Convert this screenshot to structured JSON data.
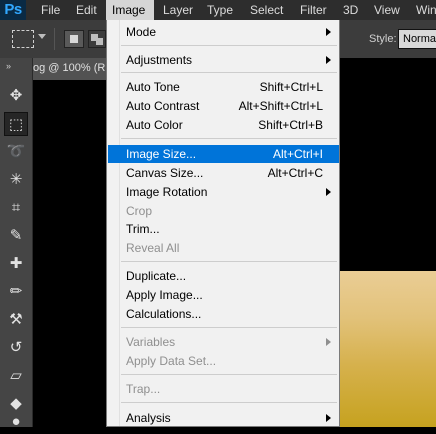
{
  "menubar": {
    "logo": "Ps",
    "items": [
      "File",
      "Edit",
      "Image",
      "Layer",
      "Type",
      "Select",
      "Filter",
      "3D",
      "View",
      "Win"
    ]
  },
  "options": {
    "style_label": "Style:",
    "style_value": "Normal"
  },
  "tools_panel": {
    "grip": "»",
    "tools": [
      "move-tool-icon",
      "rectangular-marquee-icon",
      "lasso-icon",
      "magic-wand-icon",
      "crop-icon",
      "eyedropper-icon",
      "healing-brush-icon",
      "brush-icon",
      "clone-stamp-icon",
      "history-brush-icon",
      "eraser-icon",
      "paint-bucket-icon",
      "blur-icon"
    ]
  },
  "document": {
    "tab_title": "og @ 100% (R"
  },
  "image_menu": {
    "mode": "Mode",
    "adjustments": "Adjustments",
    "auto_tone": "Auto Tone",
    "auto_tone_sc": "Shift+Ctrl+L",
    "auto_contrast": "Auto Contrast",
    "auto_contrast_sc": "Alt+Shift+Ctrl+L",
    "auto_color": "Auto Color",
    "auto_color_sc": "Shift+Ctrl+B",
    "image_size": "Image Size...",
    "image_size_sc": "Alt+Ctrl+I",
    "canvas_size": "Canvas Size...",
    "canvas_size_sc": "Alt+Ctrl+C",
    "image_rotation": "Image Rotation",
    "crop": "Crop",
    "trim": "Trim...",
    "reveal_all": "Reveal All",
    "duplicate": "Duplicate...",
    "apply_image": "Apply Image...",
    "calculations": "Calculations...",
    "variables": "Variables",
    "apply_data_set": "Apply Data Set...",
    "trap": "Trap...",
    "analysis": "Analysis"
  },
  "colors": {
    "highlight": "#0074d9",
    "menubar": "#2d2d2d",
    "gold_image": "#d6b14d"
  }
}
